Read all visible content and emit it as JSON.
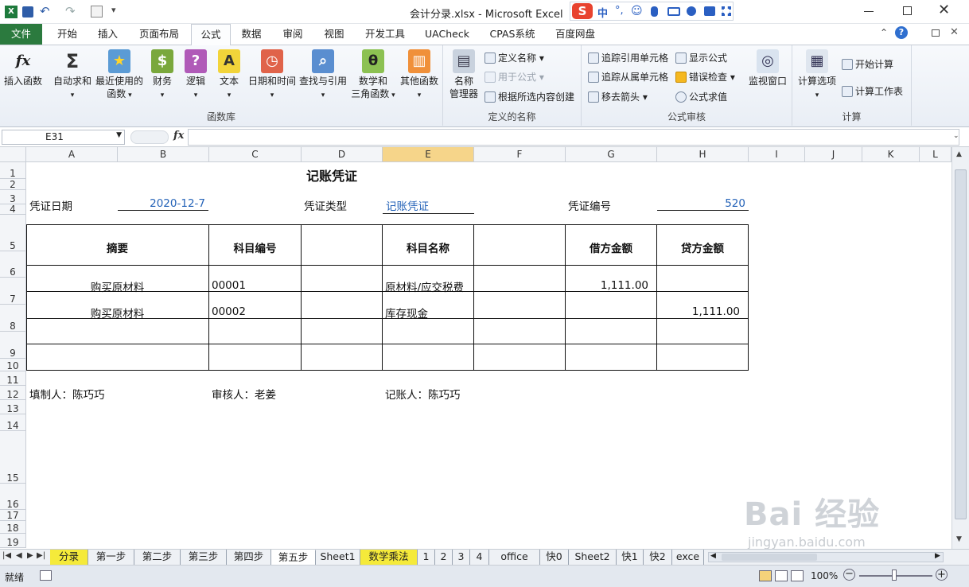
{
  "window": {
    "title": "会计分录.xlsx  -  Microsoft Excel"
  },
  "ime": {
    "logo": "S",
    "items": [
      "中",
      "°,",
      "☺",
      "🎤",
      "⌨",
      "👥",
      "👕",
      "▦"
    ]
  },
  "tabs": [
    {
      "label": "文件"
    },
    {
      "label": "开始"
    },
    {
      "label": "插入"
    },
    {
      "label": "页面布局"
    },
    {
      "label": "公式"
    },
    {
      "label": "数据"
    },
    {
      "label": "审阅"
    },
    {
      "label": "视图"
    },
    {
      "label": "开发工具"
    },
    {
      "label": "UACheck"
    },
    {
      "label": "CPAS系统"
    },
    {
      "label": "百度网盘"
    }
  ],
  "ribbon": {
    "groups": [
      {
        "label": "函数库"
      },
      {
        "label": "定义的名称"
      },
      {
        "label": "公式审核"
      },
      {
        "label": "计算"
      }
    ],
    "insert_function": "插入函数",
    "autosum": "自动求和",
    "recent": "最近使用的",
    "recent2": "函数",
    "finance": "财务",
    "logic": "逻辑",
    "text": "文本",
    "datetime": "日期和时间",
    "lookup": "查找与引用",
    "math": "数学和",
    "math2": "三角函数",
    "other": "其他函数",
    "name_mgr": "名称",
    "name_mgr2": "管理器",
    "define_name": "定义名称",
    "use_in_formula": "用于公式",
    "create_from_sel": "根据所选内容创建",
    "trace_precedents": "追踪引用单元格",
    "trace_dependents": "追踪从属单元格",
    "remove_arrows": "移去箭头",
    "show_formulas": "显示公式",
    "error_check": "错误检查",
    "eval_formula": "公式求值",
    "watch_window": "监视窗口",
    "calc_options": "计算选项",
    "calc_now": "开始计算",
    "calc_sheet": "计算工作表"
  },
  "formula_bar": {
    "name_box": "E31",
    "fx": "fx",
    "formula": ""
  },
  "columns": [
    "A",
    "B",
    "C",
    "D",
    "E",
    "F",
    "G",
    "H",
    "I",
    "J",
    "K",
    "L"
  ],
  "rows": [
    "1",
    "2",
    "3",
    "4",
    "5",
    "6",
    "7",
    "8",
    "9",
    "10",
    "11",
    "12",
    "13",
    "14",
    "15",
    "16",
    "17",
    "18",
    "19"
  ],
  "voucher": {
    "title": "记账凭证",
    "date_label": "凭证日期",
    "date_value": "2020-12-7",
    "type_label": "凭证类型",
    "type_value": "记账凭证",
    "number_label": "凭证编号",
    "number_value": "520",
    "headers": {
      "summary": "摘要",
      "account_code": "科目编号",
      "account_name": "科目名称",
      "debit": "借方金额",
      "credit": "贷方金额"
    },
    "lines": [
      {
        "summary": "购买原材料",
        "code": "00001",
        "name": "原材料/应交税费",
        "debit": "1,111.00",
        "credit": ""
      },
      {
        "summary": "购买原材料",
        "code": "00002",
        "name": "库存现金",
        "debit": "",
        "credit": "1,111.00"
      }
    ],
    "preparer": "填制人：陈巧巧",
    "reviewer": "审核人：老姜",
    "bookkeeper": "记账人：陈巧巧"
  },
  "sheet_tabs": [
    {
      "label": "分录"
    },
    {
      "label": "第一步"
    },
    {
      "label": "第二步"
    },
    {
      "label": "第三步"
    },
    {
      "label": "第四步"
    },
    {
      "label": "第五步"
    },
    {
      "label": "Sheet1"
    },
    {
      "label": "数学乘法"
    },
    {
      "label": "1"
    },
    {
      "label": "2"
    },
    {
      "label": "3"
    },
    {
      "label": "4"
    },
    {
      "label": "office"
    },
    {
      "label": "快0"
    },
    {
      "label": "Sheet2"
    },
    {
      "label": "快1"
    },
    {
      "label": "快2"
    },
    {
      "label": "exce"
    }
  ],
  "status": {
    "ready": "就绪",
    "zoom": "100%"
  },
  "watermark": {
    "brand": "Bai 经验",
    "url": "jingyan.baidu.com"
  },
  "colors": {
    "file_tab": "#2b7a3e",
    "accent_blue": "#2563b8",
    "tab_yellow": "#f5ea3a",
    "selected_col": "#f6d58a"
  }
}
